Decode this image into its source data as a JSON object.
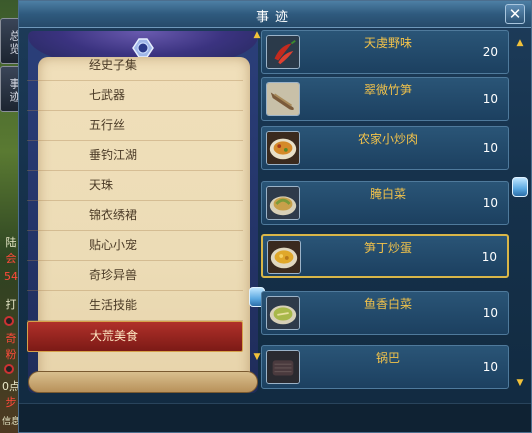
{
  "window": {
    "title": "事迹",
    "close_glyph": "✕"
  },
  "background_hud": {
    "tabs": [
      "总览",
      "事迹"
    ],
    "side_texts": [
      "陆",
      "会",
      "54",
      "打",
      "奇",
      "粉",
      "0点",
      "步",
      "信息"
    ]
  },
  "categories": [
    {
      "label": "经史子集",
      "selected": false
    },
    {
      "label": "七武器",
      "selected": false
    },
    {
      "label": "五行丝",
      "selected": false
    },
    {
      "label": "垂钓江湖",
      "selected": false
    },
    {
      "label": "天珠",
      "selected": false
    },
    {
      "label": "锦衣绣裙",
      "selected": false
    },
    {
      "label": "贴心小宠",
      "selected": false
    },
    {
      "label": "奇珍异兽",
      "selected": false
    },
    {
      "label": "生活技能",
      "selected": false
    },
    {
      "label": "大荒美食",
      "selected": true
    }
  ],
  "items": [
    {
      "name": "天虔野味",
      "qty": "20",
      "icon": "chili-pepper-icon",
      "highlight": false
    },
    {
      "name": "翠微竹笋",
      "qty": "10",
      "icon": "bamboo-shoot-icon",
      "highlight": false
    },
    {
      "name": "农家小炒肉",
      "qty": "10",
      "icon": "stir-fry-pork-icon",
      "highlight": false
    },
    {
      "name": "腌白菜",
      "qty": "10",
      "icon": "pickled-cabbage-icon",
      "highlight": false
    },
    {
      "name": "笋丁炒蛋",
      "qty": "10",
      "icon": "egg-dish-icon",
      "highlight": true
    },
    {
      "name": "鱼香白菜",
      "qty": "10",
      "icon": "cabbage-dish-icon",
      "highlight": false
    },
    {
      "name": "锅巴",
      "qty": "10",
      "icon": "rice-crust-icon",
      "highlight": false
    }
  ],
  "colors": {
    "item_name": "#f2c24a",
    "selected_category": "#9a241f",
    "highlight_border": "#d9b648"
  },
  "scroll_arrows": {
    "up": "▲",
    "down": "▼"
  }
}
